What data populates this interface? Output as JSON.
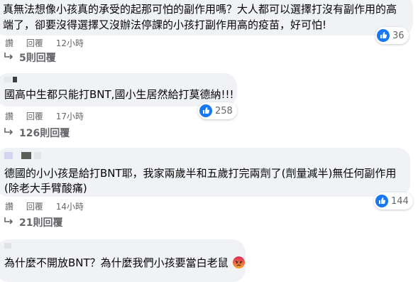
{
  "comments": [
    {
      "lines": [
        "真無法想像小孩真的承受的起那可怕的副作用嗎？大人都可以選擇打沒有副作用的高",
        "端了，卻要沒得選擇又沒辦法停課的小孩打副作用高的疫苗，好可怕!"
      ],
      "actions": {
        "like": "讚",
        "reply": "回覆",
        "time": "12小時"
      },
      "reaction_count": "36",
      "reply_link": "5則回覆"
    },
    {
      "lines": [
        "國高中生都只能打BNT,國小生居然給打莫德納!!!"
      ],
      "actions": {
        "like": "讚",
        "reply": "回覆",
        "time": "17小時"
      },
      "reaction_count": "258",
      "reply_link": "126則回覆"
    },
    {
      "lines": [
        "德國的小小孩是給打BNT耶，我家兩歲半和五歲打完兩劑了(劑量減半)無任何副作用",
        "(除老大手臂酸痛)"
      ],
      "actions": {
        "like": "讚",
        "reply": "回覆",
        "time": "14小時"
      },
      "reaction_count": "144",
      "reply_link": "21則回覆"
    },
    {
      "lines": [
        "為什麼不開放BNT？為什麼我們小孩要當白老鼠"
      ],
      "emoji": "angry-face-icon"
    }
  ],
  "colors": {
    "bubble": "#f0f2f5",
    "like_blue": "#1877f2",
    "meta_gray": "#65676b",
    "angry": "#e9710f"
  }
}
